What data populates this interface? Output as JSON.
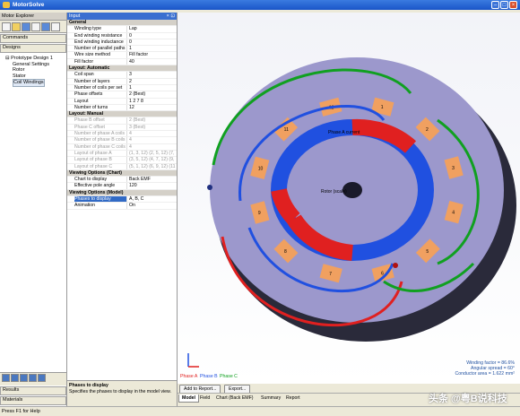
{
  "app": {
    "title": "MotorSolve"
  },
  "explorer": {
    "title": "Motor Explorer",
    "commands_label": "Commands",
    "designs_label": "Designs",
    "tree": [
      {
        "label": "Prototype Design 1",
        "level": 1
      },
      {
        "label": "General Settings",
        "level": 2
      },
      {
        "label": "Rotor",
        "level": 2
      },
      {
        "label": "Stator",
        "level": 2
      },
      {
        "label": "Coil Windings",
        "level": 2,
        "selected": true
      }
    ],
    "results_label": "Results",
    "materials_label": "Materials"
  },
  "input": {
    "title": "Input",
    "properties": [
      {
        "type": "cat",
        "k": "General"
      },
      {
        "k": "Winding type",
        "v": "Lap"
      },
      {
        "k": "End winding resistance",
        "v": "0"
      },
      {
        "k": "End winding inductance",
        "v": "0"
      },
      {
        "k": "Number of parallel paths",
        "v": "1"
      },
      {
        "k": "Wire size method",
        "v": "Fill factor"
      },
      {
        "k": "Fill factor",
        "v": "40"
      },
      {
        "type": "cat",
        "k": "Layout: Automatic"
      },
      {
        "k": "Coil span",
        "v": "3"
      },
      {
        "k": "Number of layers",
        "v": "2"
      },
      {
        "k": "Number of coils per set",
        "v": "1"
      },
      {
        "k": "Phase offsets",
        "v": "2 (Best)"
      },
      {
        "k": "Layout",
        "v": "1 2 7 8"
      },
      {
        "k": "Number of turns",
        "v": "12"
      },
      {
        "type": "cat",
        "k": "Layout: Manual"
      },
      {
        "type": "dis",
        "k": "Phase B offset",
        "v": "2 (Best)"
      },
      {
        "type": "dis",
        "k": "Phase C offset",
        "v": "3 (Best)"
      },
      {
        "type": "dis",
        "k": "Number of phase A coils",
        "v": "4"
      },
      {
        "type": "dis",
        "k": "Number of phase B coils",
        "v": "4"
      },
      {
        "type": "dis",
        "k": "Number of phase C coils",
        "v": "4"
      },
      {
        "type": "dis",
        "k": "Layout of phase A",
        "v": "(1, 3, 12) (2, 5, 12) (7,"
      },
      {
        "type": "dis",
        "k": "Layout of phase B",
        "v": "(3, 5, 12) (4, 7, 12) (9,"
      },
      {
        "type": "dis",
        "k": "Layout of phase C",
        "v": "(5, 1, 12) (6, 9, 12) (11"
      },
      {
        "type": "cat",
        "k": "Viewing Options (Chart)"
      },
      {
        "k": "Chart to display",
        "v": "Back EMF"
      },
      {
        "k": "Effective pole angle",
        "v": "120"
      },
      {
        "type": "cat",
        "k": "Viewing Options (Model)"
      },
      {
        "type": "sel",
        "k": "Phases to display",
        "v": "A, B, C"
      },
      {
        "k": "Animation",
        "v": "On"
      }
    ],
    "desc_title": "Phases to display",
    "desc_text": "Specifies the phases to display in the model view."
  },
  "view": {
    "phase_a_label": "Phase A current",
    "rotor_label": "Rotor (scale)",
    "legend": [
      "Phase A",
      "Phase B",
      "Phase C"
    ],
    "stats": [
      "Winding factor = 86.6%",
      "Angular spread = 60°",
      "Conductor area = 1.622 mm²"
    ],
    "slot_numbers": [
      "1",
      "2",
      "3",
      "4",
      "5",
      "6",
      "7",
      "8",
      "9",
      "10",
      "11",
      "12"
    ]
  },
  "actions": {
    "add_to_report": "Add to Report...",
    "export": "Export..."
  },
  "tabs": [
    "Model",
    "Field",
    "Chart (Back EMF)",
    "Summary",
    "Report"
  ],
  "status": "Press F1 for Help",
  "watermark": "头条 @粤B说科技",
  "colors": {
    "phase_a": "#e02020",
    "phase_b": "#2050e0",
    "phase_c": "#10a020",
    "tooth": "#f0a060",
    "stator": "#9a96c8"
  }
}
